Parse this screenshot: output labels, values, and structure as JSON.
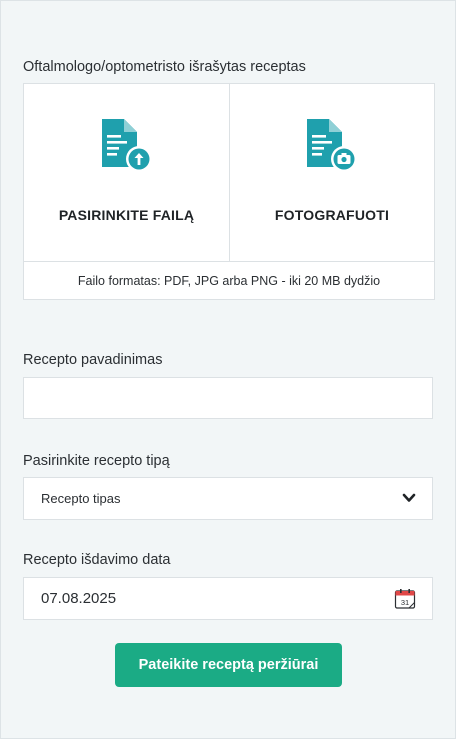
{
  "form": {
    "prescription_section_label": "Oftalmologo/optometristo išrašytas receptas",
    "upload": {
      "choose_file_label": "PASIRINKITE FAILĄ",
      "take_photo_label": "FOTOGRAFUOTI",
      "format_note": "Failo formatas: PDF, JPG arba PNG - iki 20 MB dydžio"
    },
    "name_field": {
      "label": "Recepto pavadinimas",
      "value": ""
    },
    "type_field": {
      "label": "Pasirinkite recepto tipą",
      "selected": "Recepto tipas"
    },
    "date_field": {
      "label": "Recepto išdavimo data",
      "value": "07.08.2025",
      "calendar_day": "31"
    },
    "submit_label": "Pateikite receptą peržiūrai"
  },
  "colors": {
    "accent": "#1bab85",
    "icon": "#1fa0ad",
    "background": "#f2f6f7"
  },
  "icons": [
    "document-upload-icon",
    "document-camera-icon",
    "chevron-down-icon",
    "calendar-icon"
  ]
}
